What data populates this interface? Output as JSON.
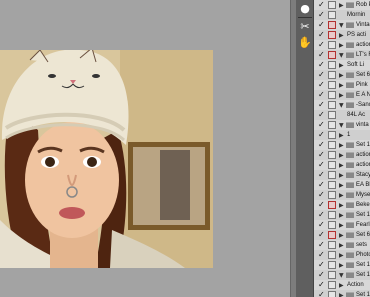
{
  "photo": {
    "description_icon": "photo-canvas"
  },
  "tools": [
    {
      "icon": "info-icon",
      "glyph": "●"
    },
    {
      "icon": "scissors-icon",
      "glyph": "✂"
    },
    {
      "icon": "pawprint-icon",
      "glyph": "✋"
    }
  ],
  "actions": [
    {
      "label": "Rob P",
      "check": "✓",
      "red": false,
      "tri": "▶",
      "folder": true
    },
    {
      "label": "Mornin",
      "check": "✓",
      "red": false,
      "tri": "",
      "folder": false
    },
    {
      "label": "Vintag",
      "check": "✓",
      "red": true,
      "tri": "▼",
      "folder": true
    },
    {
      "label": "PS acti",
      "check": "✓",
      "red": true,
      "tri": "▶",
      "folder": false
    },
    {
      "label": "action",
      "check": "✓",
      "red": false,
      "tri": "▶",
      "folder": true
    },
    {
      "label": "LT's F",
      "check": "✓",
      "red": true,
      "tri": "▼",
      "folder": true
    },
    {
      "label": "Soft Li",
      "check": "✓",
      "red": false,
      "tri": "▶",
      "folder": false
    },
    {
      "label": "Set 6",
      "check": "✓",
      "red": false,
      "tri": "▶",
      "folder": true
    },
    {
      "label": "Pink",
      "check": "✓",
      "red": false,
      "tri": "▶",
      "folder": true
    },
    {
      "label": "E A N",
      "check": "✓",
      "red": false,
      "tri": "▶",
      "folder": true
    },
    {
      "label": "-Sanc",
      "check": "✓",
      "red": false,
      "tri": "▼",
      "folder": true
    },
    {
      "label": "84L Ac",
      "check": "✓",
      "red": false,
      "tri": "",
      "folder": false
    },
    {
      "label": "vinta",
      "check": "✓",
      "red": false,
      "tri": "▼",
      "folder": true
    },
    {
      "label": "1",
      "check": "✓",
      "red": false,
      "tri": "▶",
      "folder": false
    },
    {
      "label": "Set 1",
      "check": "✓",
      "red": false,
      "tri": "▶",
      "folder": true
    },
    {
      "label": "action",
      "check": "✓",
      "red": false,
      "tri": "▶",
      "folder": true
    },
    {
      "label": "action",
      "check": "✓",
      "red": false,
      "tri": "▶",
      "folder": true
    },
    {
      "label": "Stacy0",
      "check": "✓",
      "red": false,
      "tri": "▶",
      "folder": true
    },
    {
      "label": "EA Bl",
      "check": "✓",
      "red": false,
      "tri": "▶",
      "folder": true
    },
    {
      "label": "Mysel",
      "check": "✓",
      "red": false,
      "tri": "▶",
      "folder": true
    },
    {
      "label": "Bekeh",
      "check": "✓",
      "red": true,
      "tri": "▶",
      "folder": true
    },
    {
      "label": "Set 1",
      "check": "✓",
      "red": false,
      "tri": "▶",
      "folder": true
    },
    {
      "label": "Fearl",
      "check": "✓",
      "red": false,
      "tri": "▶",
      "folder": true
    },
    {
      "label": "Set 6",
      "check": "✓",
      "red": true,
      "tri": "▶",
      "folder": true
    },
    {
      "label": "sets",
      "check": "✓",
      "red": false,
      "tri": "▶",
      "folder": true
    },
    {
      "label": "Photo",
      "check": "✓",
      "red": false,
      "tri": "▶",
      "folder": true
    },
    {
      "label": "Set 1",
      "check": "✓",
      "red": false,
      "tri": "▶",
      "folder": true
    },
    {
      "label": "Set 1",
      "check": "✓",
      "red": false,
      "tri": "▼",
      "folder": true
    },
    {
      "label": "Action",
      "check": "✓",
      "red": false,
      "tri": "▶",
      "folder": false
    },
    {
      "label": "Set 1",
      "check": "✓",
      "red": false,
      "tri": "▶",
      "folder": true
    }
  ]
}
